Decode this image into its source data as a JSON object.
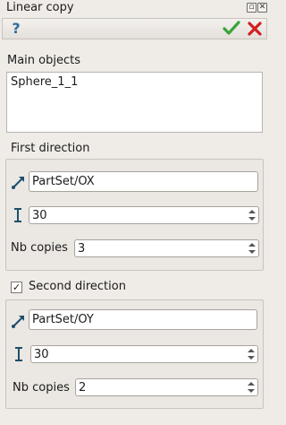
{
  "window": {
    "title": "Linear copy",
    "float_glyph": "▫",
    "close_glyph": "✕"
  },
  "toolbar": {
    "help_glyph": "?",
    "ok_icon": "check-icon",
    "cancel_icon": "x-icon"
  },
  "main_objects": {
    "label": "Main objects",
    "items": [
      "Sphere_1_1"
    ]
  },
  "first_direction": {
    "label": "First direction",
    "axis_value": "PartSet/OX",
    "distance_value": "30",
    "nb_copies_label": "Nb copies",
    "nb_copies_value": "3"
  },
  "second_direction": {
    "label": "Second direction",
    "checked": true,
    "check_glyph": "✓",
    "axis_value": "PartSet/OY",
    "distance_value": "30",
    "nb_copies_label": "Nb copies",
    "nb_copies_value": "2"
  },
  "colors": {
    "ok_green": "#3aa33a",
    "cancel_red": "#d02020",
    "help_blue": "#2f6c99"
  }
}
